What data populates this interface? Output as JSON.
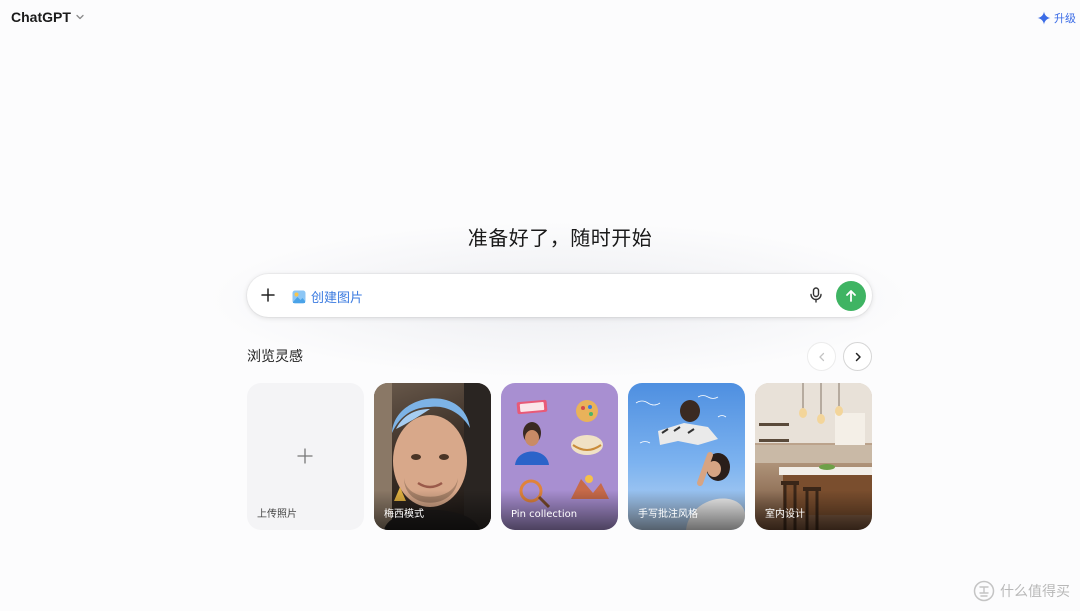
{
  "header": {
    "model_name": "ChatGPT",
    "upgrade_label": "升级",
    "accent_color": "#3b6ce6"
  },
  "main": {
    "headline": "准备好了，随时开始",
    "composer": {
      "tool_chip_label": "创建图片",
      "send_color": "#3fb463"
    }
  },
  "inspiration": {
    "title": "浏览灵感",
    "cards": [
      {
        "label": "上传照片",
        "icon": "plus-icon"
      },
      {
        "label": "梅西模式"
      },
      {
        "label": "Pin collection"
      },
      {
        "label": "手写批注风格"
      },
      {
        "label": "室内设计"
      }
    ]
  },
  "watermark": {
    "text": "什么值得买"
  }
}
